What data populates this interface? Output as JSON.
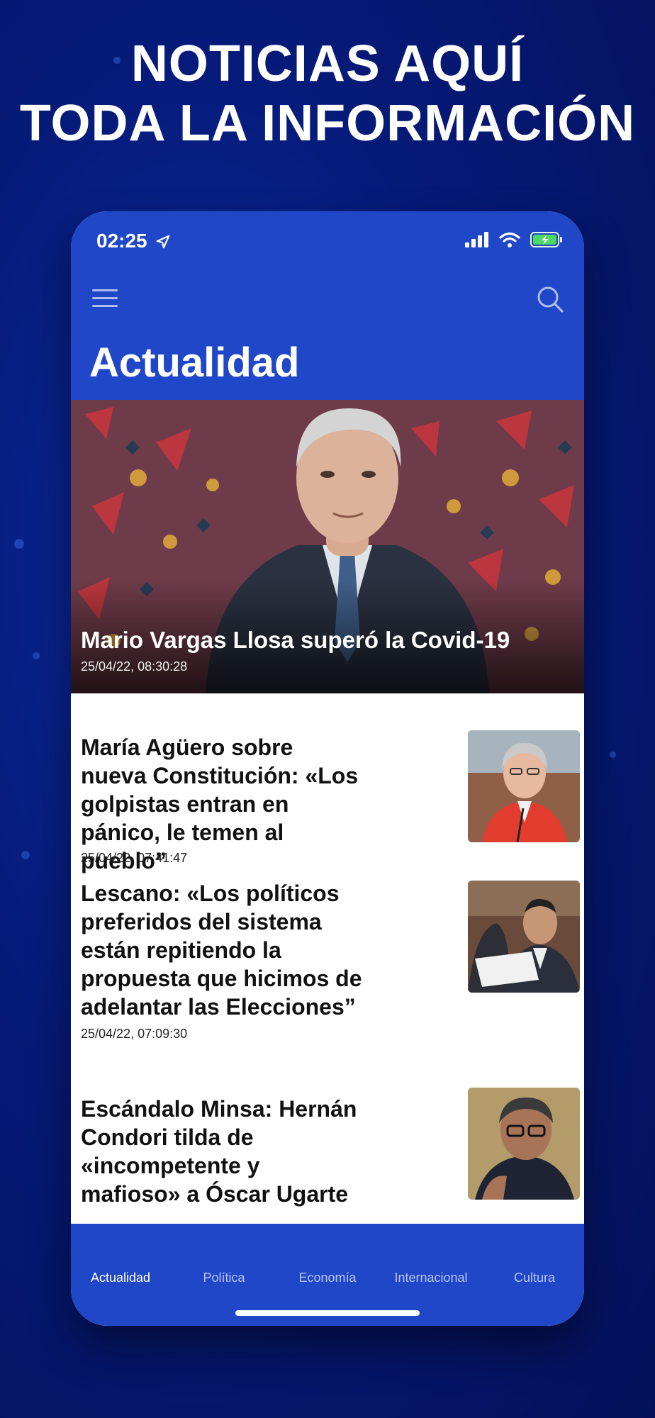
{
  "banner": {
    "line1": "NOTICIAS AQUÍ",
    "line2": "TODA LA INFORMACIÓN"
  },
  "status_bar": {
    "time": "02:25",
    "icons": [
      "location-arrow-icon",
      "signal-bars-icon",
      "wifi-icon",
      "battery-charging-icon"
    ]
  },
  "header": {
    "menu_icon": "hamburger-menu-icon",
    "search_icon": "search-icon",
    "title": "Actualidad"
  },
  "hero": {
    "title": "Mario Vargas Llosa superó la Covid-19",
    "date": "25/04/22, 08:30:28"
  },
  "articles": [
    {
      "title": "María Agüero sobre nueva Constitución: «Los golpistas entran en pánico, le temen al pueblo”",
      "date": "25/04/22, 07:41:47"
    },
    {
      "title": "Lescano: «Los políticos preferidos del sistema están repitiendo la propuesta que hicimos de adelantar las Elecciones”",
      "date": "25/04/22, 07:09:30"
    },
    {
      "title": "Escándalo Minsa: Hernán Condori tilda de «incompetente y mafioso» a Óscar Ugarte",
      "date": ""
    }
  ],
  "tabs": [
    {
      "label": "Actualidad",
      "active": true
    },
    {
      "label": "Política",
      "active": false
    },
    {
      "label": "Economía",
      "active": false
    },
    {
      "label": "Internacional",
      "active": false
    },
    {
      "label": "Cultura",
      "active": false
    }
  ],
  "colors": {
    "brand_blue": "#2047c8",
    "background_navy": "#061a78",
    "battery_green": "#4cd964"
  }
}
